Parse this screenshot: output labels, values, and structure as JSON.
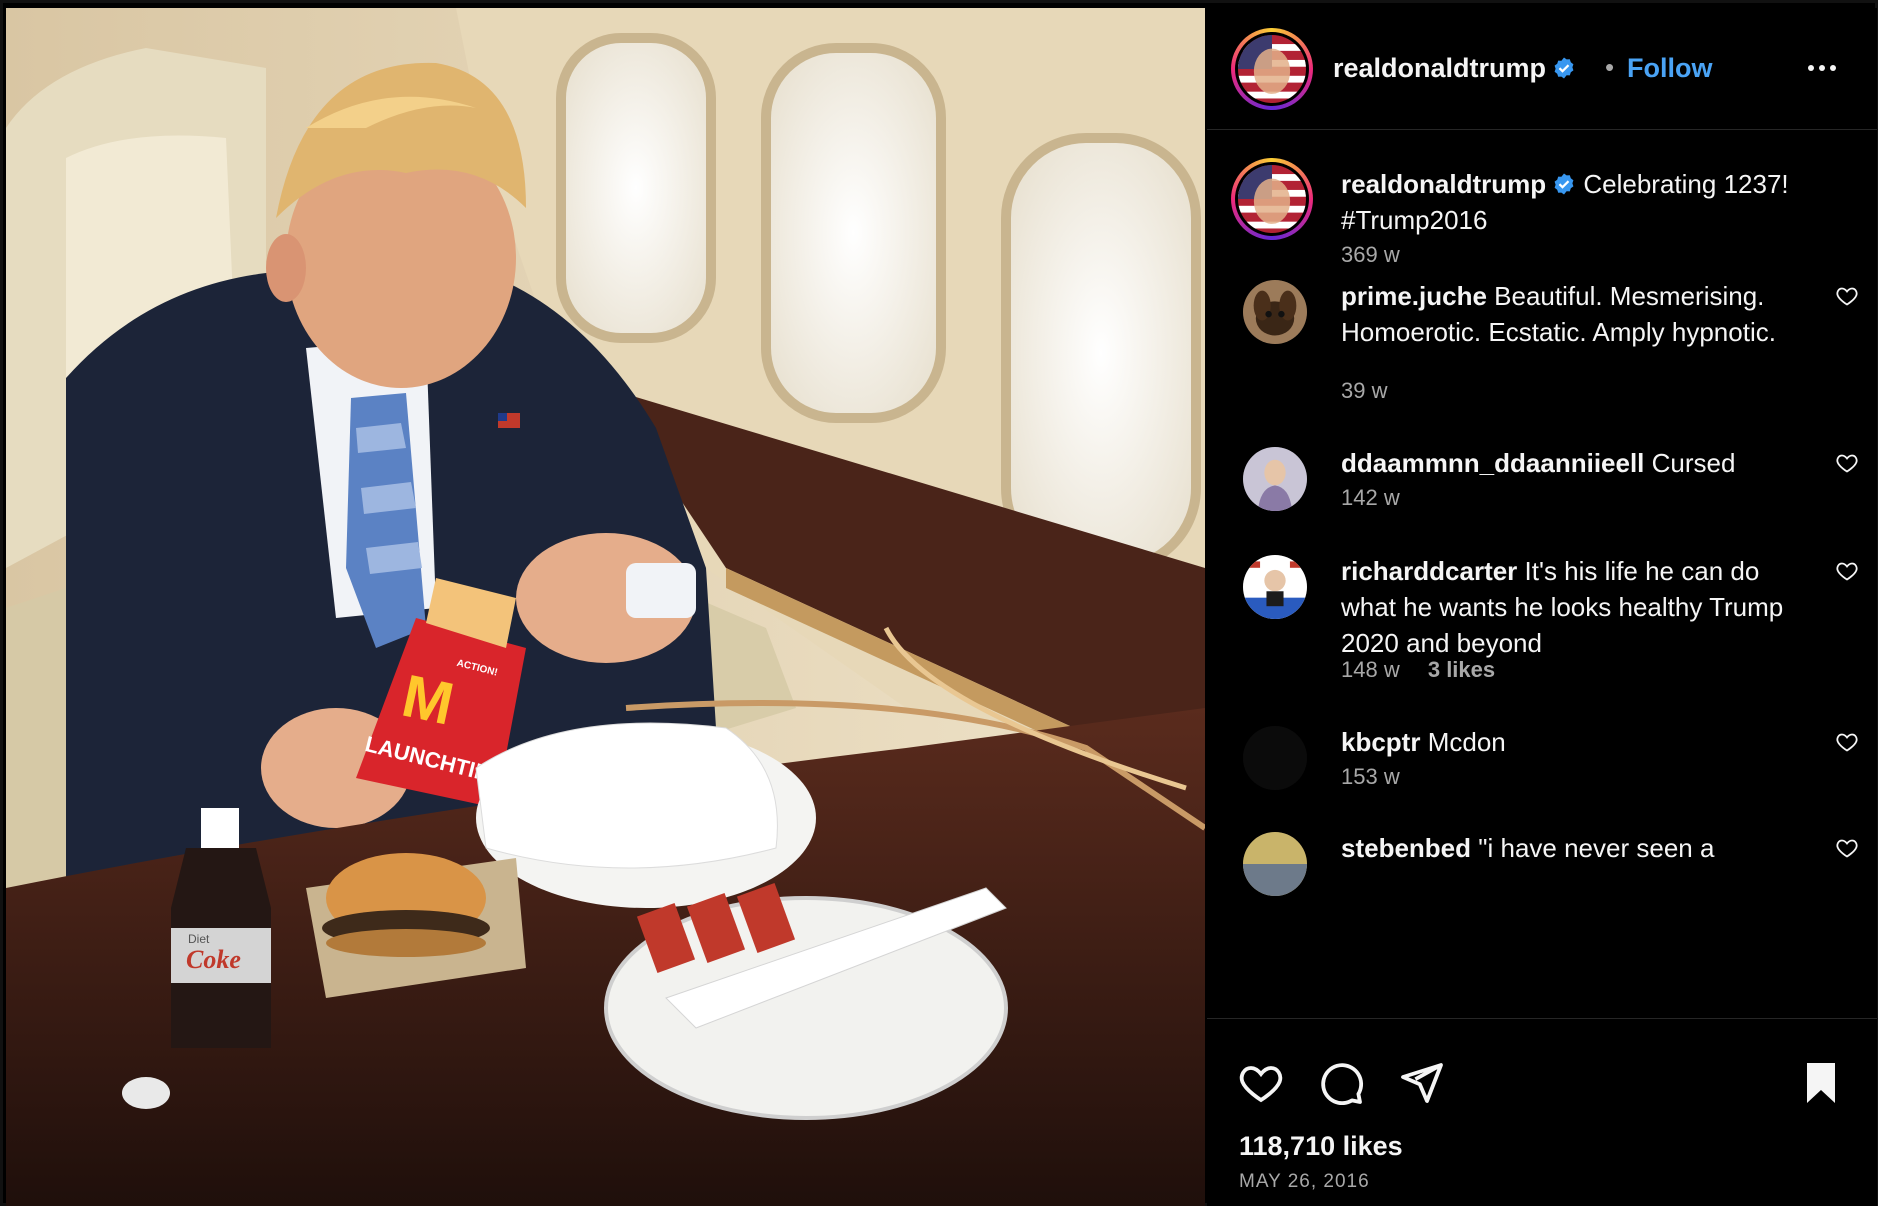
{
  "header": {
    "username": "realdonaldtrump",
    "separator": "•",
    "follow_label": "Follow"
  },
  "caption": {
    "username": "realdonaldtrump",
    "text": "Celebrating 1237! #Trump2016",
    "age": "369 w"
  },
  "comments": [
    {
      "username": "prime.juche",
      "text": "Beautiful. Mesmerising. Homoerotic. Ecstatic. Amply hypnotic.",
      "age": "39 w",
      "likes": ""
    },
    {
      "username": "ddaammnn_ddaanniieell",
      "text": "Cursed",
      "age": "142 w",
      "likes": ""
    },
    {
      "username": "richarddcarter",
      "text": "It's his life he can do what he wants he looks healthy Trump 2020 and beyond",
      "age": "148 w",
      "likes": "3 likes"
    },
    {
      "username": "kbcptr",
      "text": "Mcdon",
      "age": "153 w",
      "likes": ""
    },
    {
      "username": "stebenbed",
      "text": "\"i have never seen a",
      "age": "",
      "likes": ""
    }
  ],
  "footer": {
    "likes": "118,710 likes",
    "date": "MAY 26, 2016"
  },
  "photo": {
    "fries_box_text": "LAUNCHTIME!",
    "fries_box_tag": "ACTION!",
    "bottle_label": "Coke",
    "bottle_sublabel": "Diet"
  },
  "icons": [
    "verified-badge-icon",
    "more-options-icon",
    "heart-icon",
    "comment-icon",
    "share-icon",
    "bookmark-icon"
  ],
  "colors": {
    "accent": "#4aa3f5",
    "background": "#000000",
    "muted": "#a8a8a8",
    "text": "#f5f5f5"
  }
}
